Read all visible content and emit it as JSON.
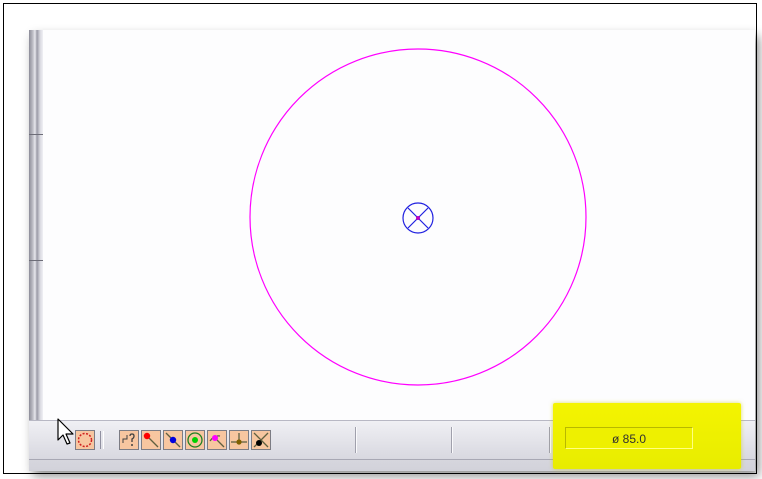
{
  "colors": {
    "circle": "#ff00ff",
    "center_mark": "#2020e0",
    "button_bg": "#f7c6a0",
    "measure_bg": "#f0f000"
  },
  "canvas": {
    "circle_center_icon": "circle-x-center-icon"
  },
  "toolbar": {
    "buttons": [
      {
        "name": "circle-tool-icon",
        "interactable": true
      },
      {
        "name": "snap-query-icon",
        "interactable": true
      },
      {
        "name": "snap-endpoint-icon",
        "interactable": true
      },
      {
        "name": "snap-midpoint-icon",
        "interactable": true
      },
      {
        "name": "snap-center-icon",
        "interactable": true
      },
      {
        "name": "snap-tangent-icon",
        "interactable": true
      },
      {
        "name": "snap-perpendicular-icon",
        "interactable": true
      },
      {
        "name": "snap-intersection-icon",
        "interactable": true
      }
    ]
  },
  "measure": {
    "value": "ø 85.0"
  }
}
